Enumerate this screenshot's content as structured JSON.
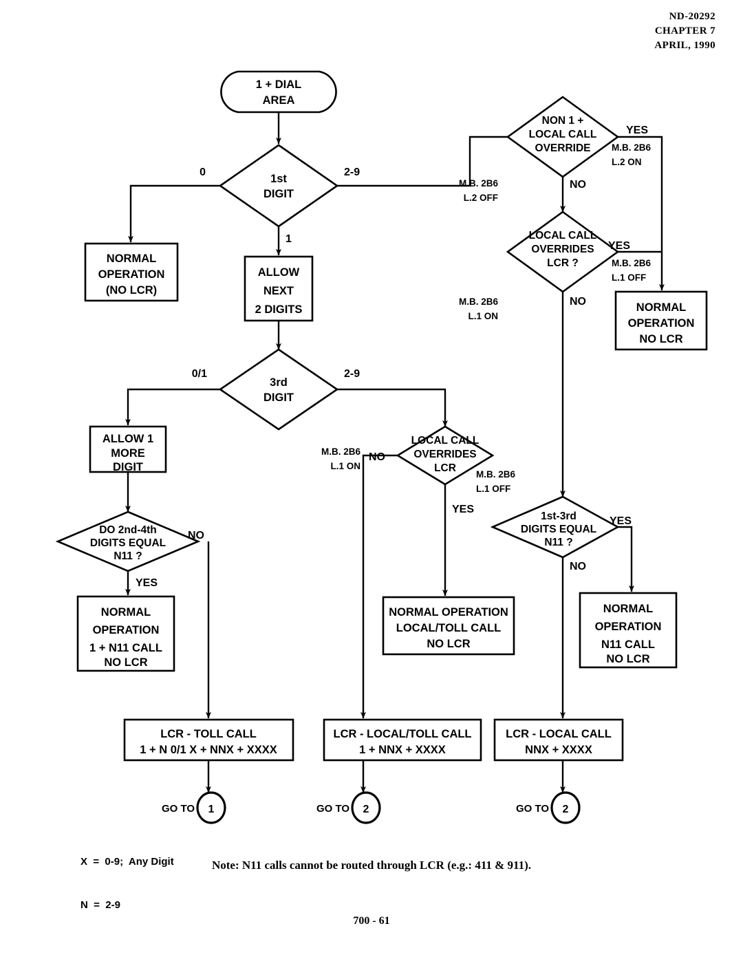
{
  "header": {
    "doc_number": "ND-20292",
    "chapter": "CHAPTER 7",
    "date": "APRIL, 1990"
  },
  "footer": {
    "page": "700 - 61"
  },
  "note": "Note: N11 calls cannot be routed through LCR (e.g.:  411 & 911).",
  "legend": {
    "line1": "X  =  0-9;  Any Digit",
    "line2": "N  =  2-9"
  },
  "nodes": {
    "start": {
      "lines": [
        "1 +  DIAL",
        "AREA"
      ]
    },
    "d_first": {
      "lines": [
        "1st",
        "DIGIT"
      ]
    },
    "b_normal_nolcr": {
      "lines": [
        "NORMAL",
        "OPERATION",
        "(NO LCR)"
      ]
    },
    "b_allow2": {
      "lines": [
        "ALLOW",
        "NEXT",
        "2 DIGITS"
      ]
    },
    "d_third": {
      "lines": [
        "3rd",
        "DIGIT"
      ]
    },
    "b_allow1": {
      "lines": [
        "ALLOW 1",
        "MORE",
        "DIGIT"
      ]
    },
    "d_2nd4th_n11": {
      "lines": [
        "DO 2nd-4th",
        "DIGITS EQUAL",
        "N11 ?"
      ]
    },
    "b_norm_1n11": {
      "lines": [
        "NORMAL",
        "OPERATION",
        "1 +  N11 CALL",
        "NO LCR"
      ]
    },
    "d_non1plus": {
      "lines": [
        "NON 1 +",
        "LOCAL CALL",
        "OVERRIDE"
      ]
    },
    "d_lco_lcr_q": {
      "lines": [
        "LOCAL CALL",
        "OVERRIDES",
        "LCR ?"
      ]
    },
    "b_norm_nolcr2": {
      "lines": [
        "NORMAL",
        "OPERATION",
        "NO LCR"
      ]
    },
    "d_lco_lcr": {
      "lines": [
        "LOCAL CALL",
        "OVERRIDES",
        "LCR"
      ]
    },
    "b_norm_localtoll": {
      "lines": [
        "NORMAL OPERATION",
        "LOCAL/TOLL CALL",
        "NO LCR"
      ]
    },
    "d_1st3rd_n11": {
      "lines": [
        "1st-3rd",
        "DIGITS EQUAL",
        "N11 ?"
      ]
    },
    "b_norm_n11": {
      "lines": [
        "NORMAL",
        "OPERATION",
        "N11 CALL",
        "NO LCR"
      ]
    },
    "b_lcr_toll": {
      "lines": [
        "LCR - TOLL  CALL",
        "1 + N 0/1 X + NNX + XXXX"
      ]
    },
    "b_lcr_localtoll": {
      "lines": [
        "LCR - LOCAL/TOLL CALL",
        "1 +  NNX + XXXX"
      ]
    },
    "b_lcr_local": {
      "lines": [
        "LCR - LOCAL CALL",
        "NNX  +  XXXX"
      ]
    }
  },
  "edge_labels": {
    "first_0": "0",
    "first_29": "2-9",
    "first_1": "1",
    "third_01": "0/1",
    "third_29": "2-9",
    "non1_yes": "YES",
    "non1_no": "NO",
    "lcoq_yes": "YES",
    "lcoq_no": "NO",
    "lco_no": "NO",
    "lco_yes": "YES",
    "n11_13_yes": "YES",
    "n11_13_no": "NO",
    "n11_24_no": "NO",
    "n11_24_yes": "YES"
  },
  "mb_labels": {
    "non1_yes_1": "M.B. 2B6",
    "non1_yes_2": "L.2 ON",
    "non1_no_1": "M.B. 2B6",
    "non1_no_2": "L.2 OFF",
    "lcoq_yes_1": "M.B. 2B6",
    "lcoq_yes_2": "L.1 OFF",
    "lcoq_no_1": "M.B. 2B6",
    "lcoq_no_2": "L.1 ON",
    "lco_no_1": "M.B. 2B6",
    "lco_no_2": "L.1 ON",
    "lco_yes_1": "M.B. 2B6",
    "lco_yes_2": "L.1 OFF"
  },
  "connectors": {
    "goto_label_1": "GO TO",
    "goto_target_1": "1",
    "goto_label_2": "GO TO",
    "goto_target_2": "2",
    "goto_label_3": "GO TO",
    "goto_target_3": "2"
  },
  "colors": {
    "ink": "#000000",
    "paper": "#ffffff"
  }
}
